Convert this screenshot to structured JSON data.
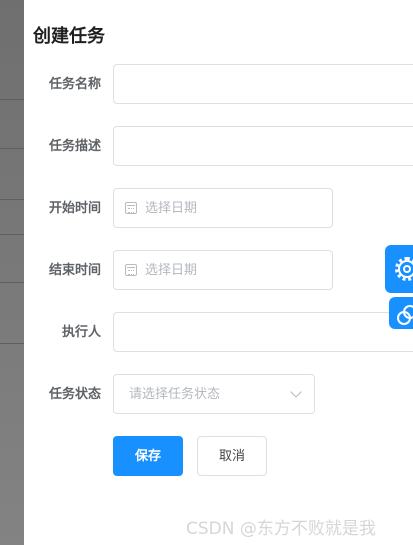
{
  "drawer": {
    "title": "创建任务"
  },
  "form": {
    "task_name": {
      "label": "任务名称",
      "value": ""
    },
    "task_desc": {
      "label": "任务描述",
      "value": ""
    },
    "start_time": {
      "label": "开始时间",
      "placeholder": "选择日期",
      "icon": "calendar-icon"
    },
    "end_time": {
      "label": "结束时间",
      "placeholder": "选择日期",
      "icon": "calendar-icon"
    },
    "assignee": {
      "label": "执行人",
      "value": ""
    },
    "status": {
      "label": "任务状态",
      "placeholder": "请选择任务状态",
      "icon": "chevron-down-icon"
    }
  },
  "actions": {
    "save_label": "保存",
    "cancel_label": "取消"
  },
  "floating": {
    "settings_icon": "gear-icon",
    "link_icon": "link-icon",
    "accent": "#1890ff"
  },
  "watermark": "CSDN @东方不败就是我"
}
